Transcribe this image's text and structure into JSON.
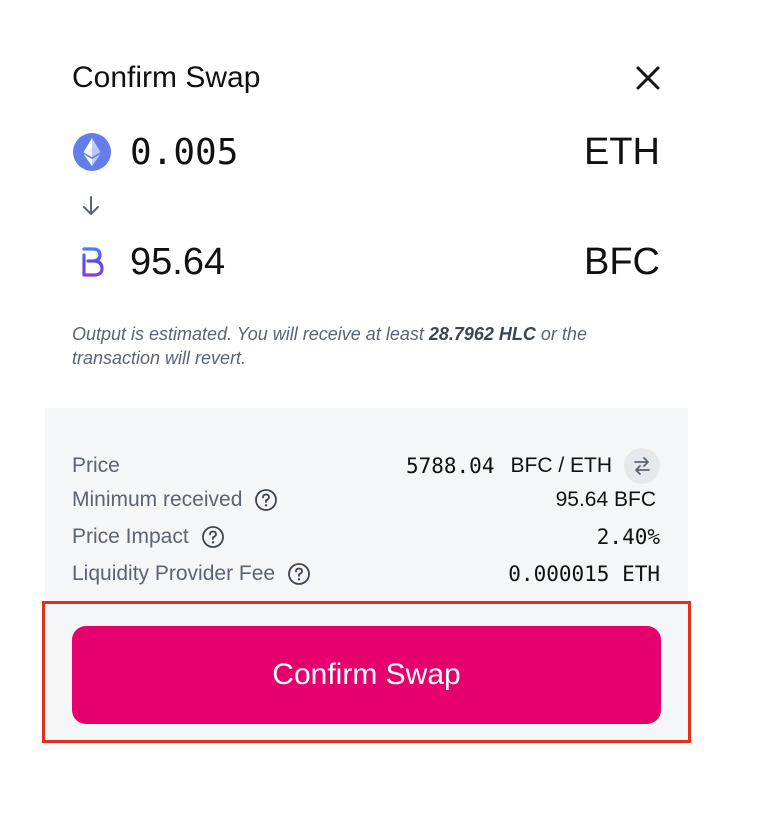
{
  "header": {
    "title": "Confirm Swap"
  },
  "input_token": {
    "amount": "0.005",
    "symbol": "ETH",
    "icon": "ethereum-icon"
  },
  "output_token": {
    "amount": "95.64",
    "symbol": "BFC",
    "icon": "bifrost-icon"
  },
  "note": {
    "prefix": "Output is estimated. You will receive at least ",
    "min_amount": "28.7962 HLC",
    "suffix": " or the transaction will revert."
  },
  "details": {
    "price": {
      "label": "Price",
      "value": "5788.04",
      "unit": "BFC / ETH"
    },
    "minimum_received": {
      "label": "Minimum received",
      "value": "95.64 BFC"
    },
    "price_impact": {
      "label": "Price Impact",
      "value": "2.40%"
    },
    "lp_fee": {
      "label": "Liquidity Provider Fee",
      "value": "0.000015 ETH"
    }
  },
  "confirm_button": {
    "label": "Confirm Swap"
  },
  "colors": {
    "accent": "#e6006e",
    "eth_icon": "#627eea",
    "highlight_outline": "#e0301e",
    "details_bg": "#f5f6f8"
  }
}
